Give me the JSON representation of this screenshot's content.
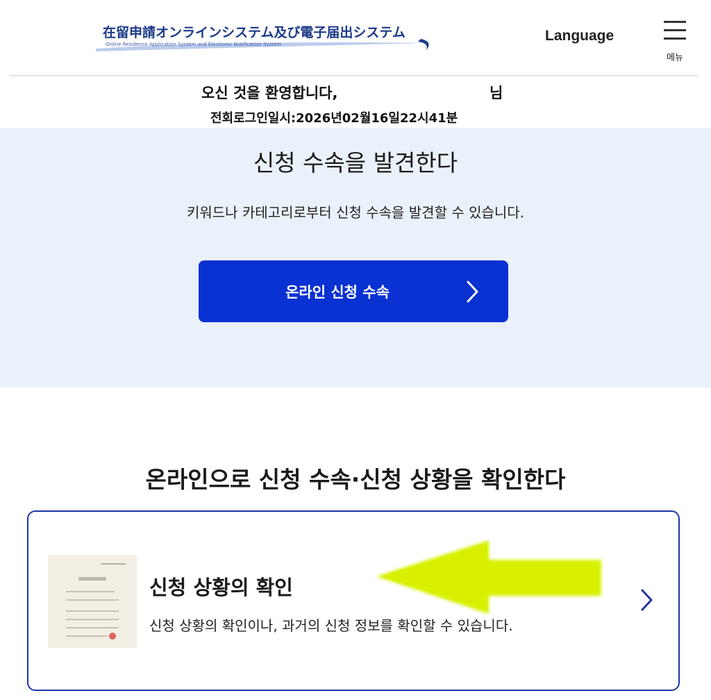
{
  "header": {
    "logo_title": "在留申請オンラインシステム及び電子届出システム",
    "logo_subtitle": "Online Residence Application System and Electronic Notification System",
    "language_label": "Language",
    "menu_label": "메뉴"
  },
  "welcome": {
    "message": "오신 것을 환영합니다,",
    "suffix": "님",
    "last_login": "전회로그인일시:2026년02월16일22시41분"
  },
  "search_section": {
    "title": "신청 수속을 발견한다",
    "description": "키워드나 카테고리로부터 신청 수속을 발견할 수 있습니다.",
    "button_label": "온라인 신청 수속"
  },
  "status_section": {
    "heading": "온라인으로 신청 수속·신청 상황을 확인한다",
    "card_title": "신청 상황의 확인",
    "card_description": "신청 상황의 확인이나, 과거의 신청 정보를 확인할 수 있습니다."
  },
  "colors": {
    "brand_blue": "#0a31d1",
    "card_border": "#1f36a8",
    "section_bg": "#e9f1fb",
    "annotation_arrow": "#d6f200"
  },
  "icons": {
    "menu": "hamburger-icon",
    "button_chevron": "chevron-right-icon",
    "card_chevron": "chevron-right-icon",
    "card_thumbnail": "document-icon",
    "annotation": "arrow-left-icon"
  }
}
